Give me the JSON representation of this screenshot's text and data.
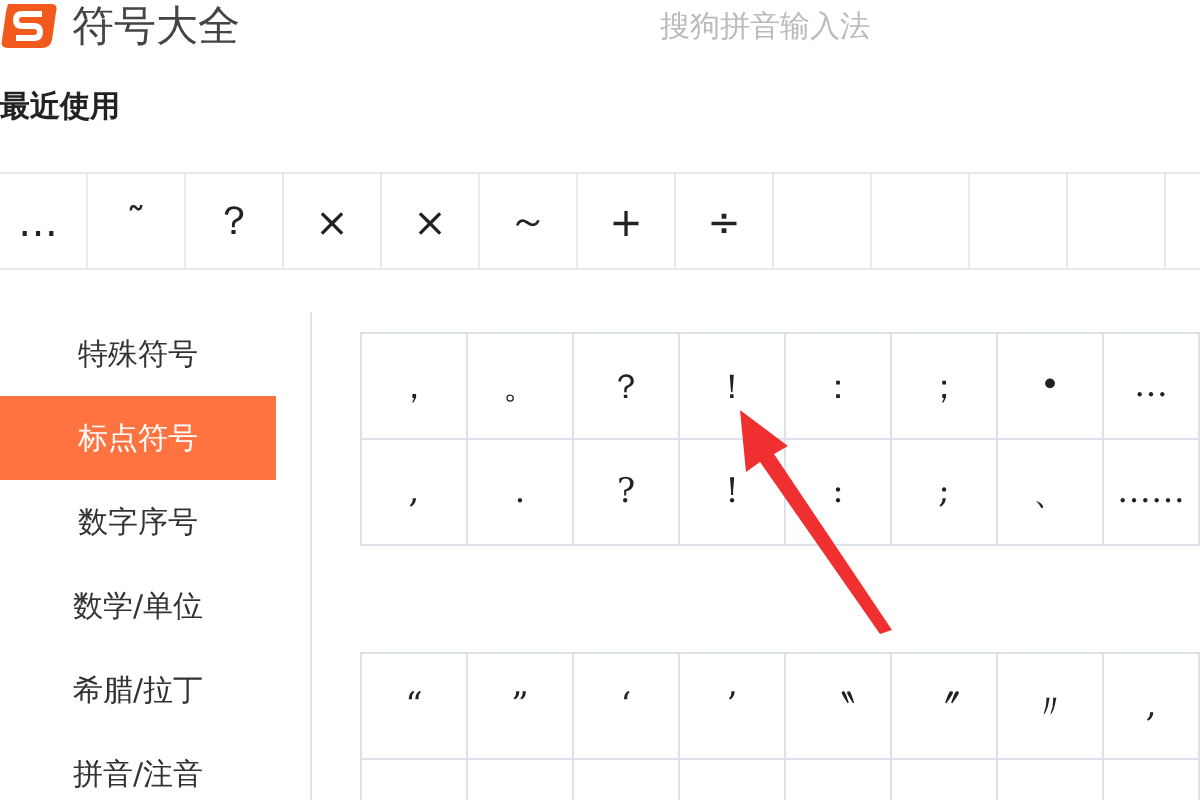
{
  "header": {
    "title": "符号大全",
    "subtitle": "搜狗拼音输入法"
  },
  "recent": {
    "title": "最近使用",
    "symbols": [
      "…",
      "˜",
      "？",
      "×",
      "×",
      "～",
      "+",
      "÷"
    ]
  },
  "sidebar": {
    "items": [
      {
        "label": "特殊符号",
        "selected": false
      },
      {
        "label": "标点符号",
        "selected": true
      },
      {
        "label": "数字序号",
        "selected": false
      },
      {
        "label": "数学/单位",
        "selected": false
      },
      {
        "label": "希腊/拉丁",
        "selected": false
      },
      {
        "label": "拼音/注音",
        "selected": false
      }
    ]
  },
  "groups": [
    {
      "rows": [
        [
          "，",
          "。",
          "？",
          "！",
          "：",
          "；",
          "•",
          "…"
        ],
        [
          ",",
          ".",
          "?",
          "!",
          ":",
          ";",
          "、",
          "……"
        ]
      ]
    },
    {
      "rows": [
        [
          "“",
          "”",
          "‘",
          "’",
          "〝",
          "〞",
          "〃",
          "‚"
        ]
      ]
    }
  ]
}
